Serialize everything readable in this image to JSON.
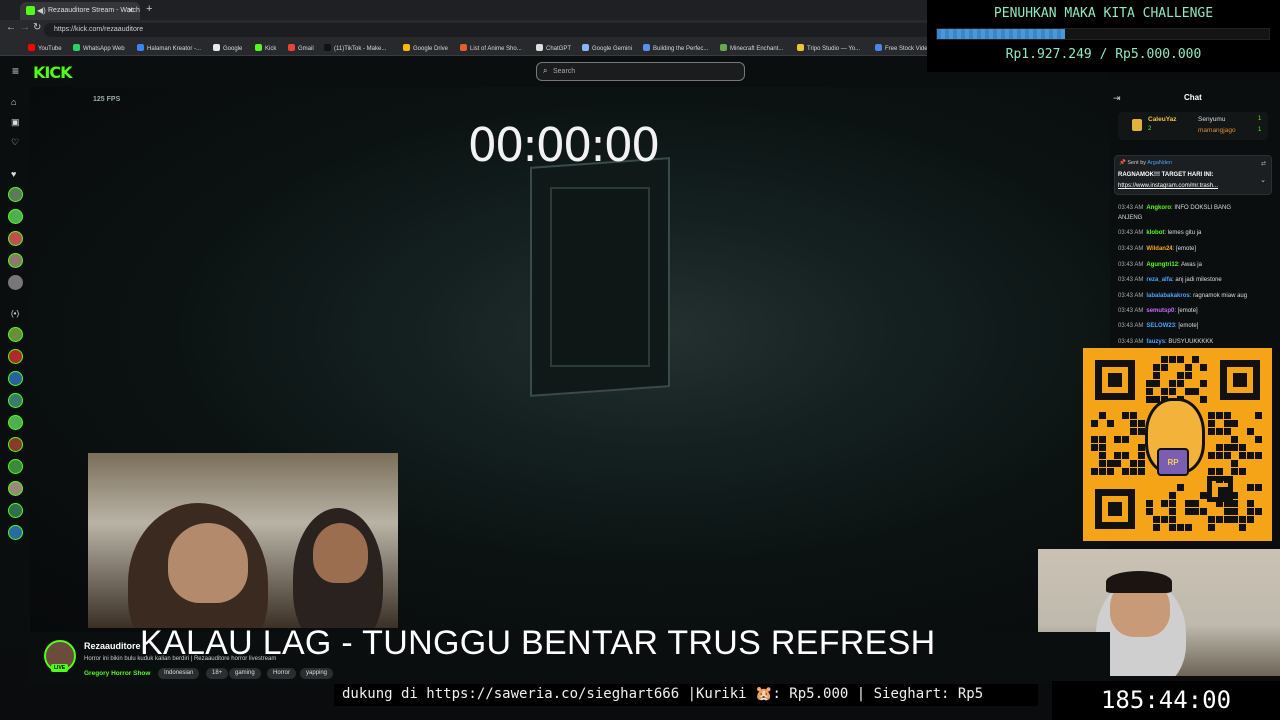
{
  "browser": {
    "tab_title": "Rezaauditore Stream - Watch",
    "url": "https://kick.com/rezaauditore",
    "bookmarks": [
      {
        "label": "YouTube",
        "color": "#ff0000"
      },
      {
        "label": "WhatsApp Web",
        "color": "#25d366"
      },
      {
        "label": "Halaman Kreator -...",
        "color": "#3b82f6"
      },
      {
        "label": "Google",
        "color": "#e8e8e8"
      },
      {
        "label": "Kick",
        "color": "#53fc18"
      },
      {
        "label": "Gmail",
        "color": "#ea4335"
      },
      {
        "label": "(11)TikTok - Make...",
        "color": "#111111"
      },
      {
        "label": "Google Drive",
        "color": "#fbbc04"
      },
      {
        "label": "List of Anime Sho...",
        "color": "#e35d2f"
      },
      {
        "label": "ChatGPT",
        "color": "#dddddd"
      },
      {
        "label": "Google Gemini",
        "color": "#8ab4f8"
      },
      {
        "label": "Building the Perfec...",
        "color": "#5b8def"
      },
      {
        "label": "Minecraft Enchant...",
        "color": "#6aa84f"
      },
      {
        "label": "Tripo Studio — Yo...",
        "color": "#f1c232"
      },
      {
        "label": "Free Stock Video",
        "color": "#4a86e8"
      }
    ]
  },
  "kick": {
    "logo": "KICK",
    "search_placeholder": "Search"
  },
  "video": {
    "fps_label": "125 FPS",
    "overlay_timer": "00:00:00"
  },
  "stream": {
    "streamer_name": "Rezaauditore",
    "title": "Horror ini bikin bulu kuduk kalian berdiri | Rezaauditore horror livestream",
    "live_badge": "LIVE",
    "category": "Gregory Horror Show",
    "tags": [
      "Indonesian",
      "18+",
      "gaming",
      "Horror",
      "yapping"
    ]
  },
  "overlay": {
    "banner": "KALAU LAG - TUNGGU BENTAR TRUS REFRESH",
    "ticker": "dukung di https://saweria.co/sieghart666 |Kuriki 🐹: Rp5.000 | Sieghart: Rp5",
    "subathon_timer": "185:44:00"
  },
  "challenge": {
    "title": "PENUHKAN MAKA KITA CHALLENGE",
    "current": "Rp1.927.249",
    "target": "Rp5.000.000",
    "amount_text": "Rp1.927.249 / Rp5.000.000",
    "progress_fraction": 0.385,
    "bar_color": "#3a86c8"
  },
  "chat": {
    "title": "Chat",
    "leaderboard": [
      {
        "user": "CaleuYaz",
        "count": "2"
      },
      {
        "user": "Senyumu",
        "count": "1"
      },
      {
        "user": "mamangjago",
        "count": "1"
      }
    ],
    "pinned": {
      "sent_by_label": "Sent by",
      "sent_by_user": "ArgaNden",
      "message": "RAGNAMOK!!! TARGET HARI INI:",
      "link": "https://www.instagram.com/mr.trash..."
    },
    "messages": [
      {
        "time": "03:43 AM",
        "user": "Angkoro",
        "color": "#53fc18",
        "text": "INFO DOKSLI BANG"
      },
      {
        "time": "",
        "user": "",
        "color": "#dddddd",
        "text": "ANJENG"
      },
      {
        "time": "03:43 AM",
        "user": "klobot",
        "color": "#53fc18",
        "text": "lemes gitu ja"
      },
      {
        "time": "03:43 AM",
        "user": "Wildan24",
        "color": "#f5a623",
        "text": "[emote]"
      },
      {
        "time": "03:43 AM",
        "user": "Agungtri12",
        "color": "#53fc18",
        "text": "Awas ja"
      },
      {
        "time": "03:43 AM",
        "user": "reza_alfa",
        "color": "#4aa3ff",
        "text": "anj jadi milestone"
      },
      {
        "time": "03:43 AM",
        "user": "labalabakakros",
        "color": "#4aa3ff",
        "text": "ragnamok miaw aug"
      },
      {
        "time": "03:43 AM",
        "user": "semutsp0",
        "color": "#c86bff",
        "text": "[emote]"
      },
      {
        "time": "03:43 AM",
        "user": "SELOW23",
        "color": "#4aa3ff",
        "text": "[emote]"
      },
      {
        "time": "03:43 AM",
        "user": "fauzys",
        "color": "#4aa3ff",
        "text": "BUSYUUKKKKK"
      }
    ]
  },
  "qr": {
    "badge": "RP"
  }
}
